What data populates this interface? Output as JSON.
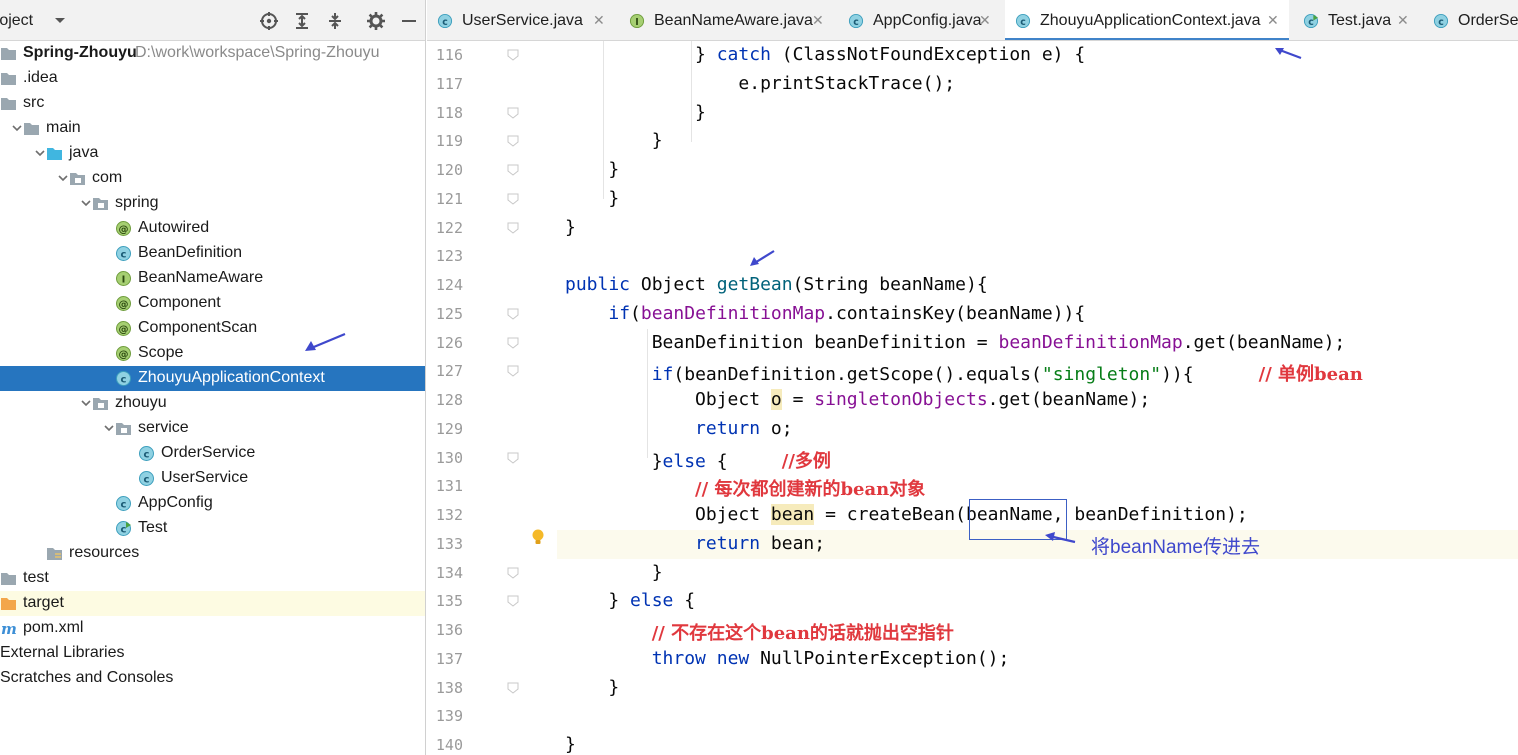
{
  "project_panel": {
    "title": "roject",
    "tree": [
      {
        "label": "Spring-Zhouyu",
        "path": "D:\\work\\workspace\\Spring-Zhouyu",
        "indent": 0,
        "icon": "module-folder-icon",
        "arrow": "none",
        "bold": true
      },
      {
        "label": ".idea",
        "indent": 0,
        "icon": "folder-icon",
        "arrow": "none"
      },
      {
        "label": "src",
        "indent": 0,
        "icon": "folder-icon",
        "arrow": "none"
      },
      {
        "label": "main",
        "indent": 1,
        "icon": "folder-icon",
        "arrow": "down"
      },
      {
        "label": "java",
        "indent": 2,
        "icon": "source-folder-icon",
        "arrow": "down"
      },
      {
        "label": "com",
        "indent": 3,
        "icon": "package-icon",
        "arrow": "down"
      },
      {
        "label": "spring",
        "indent": 4,
        "icon": "package-icon",
        "arrow": "down"
      },
      {
        "label": "Autowired",
        "indent": 5,
        "icon": "annotation-icon",
        "arrow": "none"
      },
      {
        "label": "BeanDefinition",
        "indent": 5,
        "icon": "class-icon",
        "arrow": "none"
      },
      {
        "label": "BeanNameAware",
        "indent": 5,
        "icon": "interface-icon",
        "arrow": "none"
      },
      {
        "label": "Component",
        "indent": 5,
        "icon": "annotation-icon",
        "arrow": "none"
      },
      {
        "label": "ComponentScan",
        "indent": 5,
        "icon": "annotation-icon",
        "arrow": "none"
      },
      {
        "label": "Scope",
        "indent": 5,
        "icon": "annotation-icon",
        "arrow": "none"
      },
      {
        "label": "ZhouyuApplicationContext",
        "indent": 5,
        "icon": "class-icon",
        "arrow": "none",
        "selected": true
      },
      {
        "label": "zhouyu",
        "indent": 4,
        "icon": "package-icon",
        "arrow": "down"
      },
      {
        "label": "service",
        "indent": 5,
        "icon": "package-icon",
        "arrow": "down"
      },
      {
        "label": "OrderService",
        "indent": 6,
        "icon": "class-icon",
        "arrow": "none"
      },
      {
        "label": "UserService",
        "indent": 6,
        "icon": "class-icon",
        "arrow": "none"
      },
      {
        "label": "AppConfig",
        "indent": 5,
        "icon": "class-icon",
        "arrow": "none"
      },
      {
        "label": "Test",
        "indent": 5,
        "icon": "runnable-class-icon",
        "arrow": "none"
      },
      {
        "label": "resources",
        "indent": 2,
        "icon": "resources-folder-icon",
        "arrow": "none"
      },
      {
        "label": "test",
        "indent": 0,
        "icon": "folder-icon",
        "arrow": "right"
      },
      {
        "label": "target",
        "indent": 0,
        "icon": "excluded-folder-icon",
        "arrow": "none",
        "hilite": true
      },
      {
        "label": "pom.xml",
        "indent": 0,
        "icon": "maven-icon",
        "arrow": "none"
      },
      {
        "label": "External Libraries",
        "indent": 0,
        "icon": "libraries-icon",
        "arrow": "none"
      },
      {
        "label": "Scratches and Consoles",
        "indent": 0,
        "icon": "scratches-icon",
        "arrow": "none"
      }
    ]
  },
  "tabs": [
    {
      "label": "UserService.java",
      "icon": "class-icon"
    },
    {
      "label": "BeanNameAware.java",
      "icon": "interface-icon"
    },
    {
      "label": "AppConfig.java",
      "icon": "class-icon"
    },
    {
      "label": "ZhouyuApplicationContext.java",
      "icon": "class-icon",
      "active": true
    },
    {
      "label": "Test.java",
      "icon": "runnable-class-icon"
    },
    {
      "label": "OrderSer",
      "icon": "class-icon"
    }
  ],
  "editor": {
    "lines": [
      {
        "no": "116",
        "tokens": [
          [
            "            } ",
            ""
          ],
          [
            "catch",
            "kw"
          ],
          [
            " (ClassNotFoundException e) {",
            ""
          ]
        ]
      },
      {
        "no": "117",
        "tokens": [
          [
            "                e.printStackTrace();",
            ""
          ]
        ]
      },
      {
        "no": "118",
        "tokens": [
          [
            "            }",
            ""
          ]
        ]
      },
      {
        "no": "119",
        "tokens": [
          [
            "        }",
            ""
          ]
        ]
      },
      {
        "no": "120",
        "tokens": [
          [
            "    }",
            ""
          ]
        ]
      },
      {
        "no": "121",
        "tokens": [
          [
            "",
            ""
          ]
        ]
      },
      {
        "no": "122",
        "tokens": [
          [
            "}",
            ""
          ]
        ]
      },
      {
        "no": "123",
        "tokens": [
          [
            "",
            ""
          ]
        ]
      },
      {
        "no": "124",
        "tokens": [
          [
            "public",
            "kw"
          ],
          [
            " Object ",
            ""
          ],
          [
            "getBean",
            "fn"
          ],
          [
            "(String beanName){",
            ""
          ]
        ]
      },
      {
        "no": "125",
        "tokens": [
          [
            "    ",
            ""
          ],
          [
            "if",
            "kw"
          ],
          [
            "(",
            ""
          ],
          [
            "beanDefinitionMap",
            "fld"
          ],
          [
            ".containsKey(beanName)){",
            ""
          ]
        ]
      },
      {
        "no": "126",
        "tokens": [
          [
            "        BeanDefinition beanDefinition = ",
            ""
          ],
          [
            "beanDefinitionMap",
            "fld"
          ],
          [
            ".get(beanName);",
            ""
          ]
        ]
      },
      {
        "no": "127",
        "tokens": [
          [
            "        ",
            ""
          ],
          [
            "if",
            "kw"
          ],
          [
            "(beanDefinition.getScope().equals(",
            ""
          ],
          [
            "\"singleton\"",
            "str"
          ],
          [
            ")){      ",
            ""
          ],
          [
            "// 单例bean",
            "cmt"
          ]
        ]
      },
      {
        "no": "128",
        "tokens": [
          [
            "            Object ",
            ""
          ],
          [
            "o",
            "hl"
          ],
          [
            " = ",
            ""
          ],
          [
            "singletonObjects",
            "fld"
          ],
          [
            ".get(beanName);",
            ""
          ]
        ]
      },
      {
        "no": "129",
        "tokens": [
          [
            "            ",
            ""
          ],
          [
            "return",
            "kw"
          ],
          [
            " o;",
            ""
          ]
        ]
      },
      {
        "no": "130",
        "tokens": [
          [
            "        }",
            ""
          ],
          [
            "else",
            "kw"
          ],
          [
            " {     ",
            ""
          ],
          [
            "//多例",
            "cmt"
          ]
        ]
      },
      {
        "no": "131",
        "tokens": [
          [
            "            ",
            ""
          ],
          [
            "// 每次都创建新的bean对象",
            "cmt"
          ]
        ]
      },
      {
        "no": "132",
        "tokens": [
          [
            "            Object ",
            ""
          ],
          [
            "bean",
            "hl"
          ],
          [
            " = createBean(beanName, beanDefinition);",
            ""
          ]
        ]
      },
      {
        "no": "133",
        "tokens": [
          [
            "            ",
            ""
          ],
          [
            "return",
            "kw"
          ],
          [
            " bean;",
            ""
          ]
        ]
      },
      {
        "no": "134",
        "tokens": [
          [
            "        }",
            ""
          ]
        ]
      },
      {
        "no": "135",
        "tokens": [
          [
            "    } ",
            ""
          ],
          [
            "else",
            "kw"
          ],
          [
            " {",
            ""
          ]
        ]
      },
      {
        "no": "136",
        "tokens": [
          [
            "        ",
            ""
          ],
          [
            "// 不存在这个bean的话就抛出空指针",
            "cmt"
          ]
        ]
      },
      {
        "no": "137",
        "tokens": [
          [
            "        ",
            ""
          ],
          [
            "throw",
            "kw"
          ],
          [
            " ",
            ""
          ],
          [
            "new",
            "kw"
          ],
          [
            " NullPointerException();",
            ""
          ]
        ]
      },
      {
        "no": "138",
        "tokens": [
          [
            "    }",
            ""
          ]
        ]
      },
      {
        "no": "139",
        "tokens": [
          [
            "",
            ""
          ]
        ]
      },
      {
        "no": "140",
        "tokens": [
          [
            "}",
            ""
          ]
        ]
      }
    ],
    "annotation_note": "将beanName传进去"
  },
  "colors": {
    "selection": "#2675bf",
    "keyword": "#0033b3",
    "field": "#871094",
    "comment": "#e0383e",
    "annotation": "#3f48cc"
  }
}
